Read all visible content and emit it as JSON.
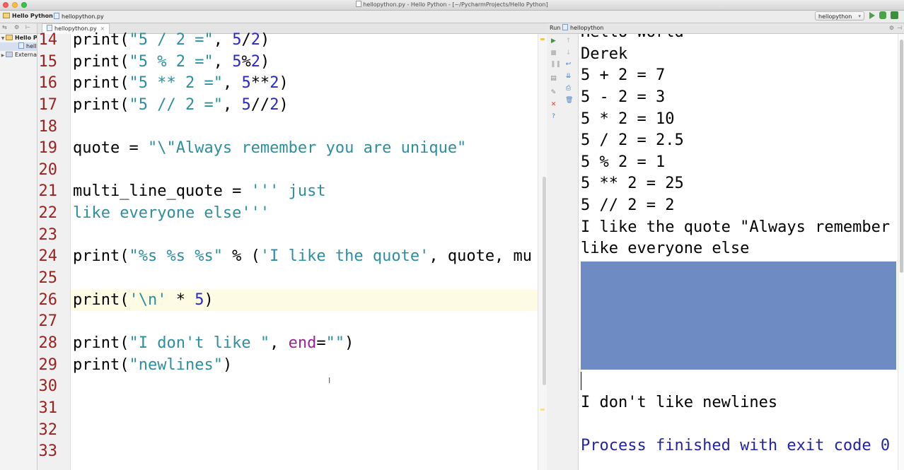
{
  "window": {
    "title": "hellopython.py - Hello Python - [~/PycharmProjects/Hello Python]"
  },
  "navbar": {
    "project": "Hello Python",
    "file": "hellopython.py",
    "run_config": "hellopython"
  },
  "project_panel": {
    "items": [
      "Hello P",
      "hell",
      "Externa"
    ]
  },
  "editor": {
    "tab_label": "hellopython.py",
    "highlighted_line": 26,
    "lines": [
      {
        "num": "14",
        "tokens": [
          [
            "p",
            "print("
          ],
          [
            "s",
            "\"5 / 2 =\""
          ],
          [
            "p",
            ", "
          ],
          [
            "n",
            "5"
          ],
          [
            "p",
            "/"
          ],
          [
            "n",
            "2"
          ],
          [
            "p",
            ")"
          ]
        ]
      },
      {
        "num": "15",
        "tokens": [
          [
            "p",
            "print("
          ],
          [
            "s",
            "\"5 % 2 =\""
          ],
          [
            "p",
            ", "
          ],
          [
            "n",
            "5"
          ],
          [
            "p",
            "%"
          ],
          [
            "n",
            "2"
          ],
          [
            "p",
            ")"
          ]
        ]
      },
      {
        "num": "16",
        "tokens": [
          [
            "p",
            "print("
          ],
          [
            "s",
            "\"5 ** 2 =\""
          ],
          [
            "p",
            ", "
          ],
          [
            "n",
            "5"
          ],
          [
            "p",
            "**"
          ],
          [
            "n",
            "2"
          ],
          [
            "p",
            ")"
          ]
        ]
      },
      {
        "num": "17",
        "tokens": [
          [
            "p",
            "print("
          ],
          [
            "s",
            "\"5 // 2 =\""
          ],
          [
            "p",
            ", "
          ],
          [
            "n",
            "5"
          ],
          [
            "p",
            "//"
          ],
          [
            "n",
            "2"
          ],
          [
            "p",
            ")"
          ]
        ]
      },
      {
        "num": "18",
        "tokens": []
      },
      {
        "num": "19",
        "tokens": [
          [
            "p",
            "quote = "
          ],
          [
            "s",
            "\"\\\"Always remember you are unique\""
          ]
        ]
      },
      {
        "num": "20",
        "tokens": []
      },
      {
        "num": "21",
        "tokens": [
          [
            "p",
            "multi_line_quote = "
          ],
          [
            "s",
            "''' just"
          ]
        ]
      },
      {
        "num": "22",
        "tokens": [
          [
            "s",
            "like everyone else'''"
          ]
        ]
      },
      {
        "num": "23",
        "tokens": []
      },
      {
        "num": "24",
        "tokens": [
          [
            "p",
            "print("
          ],
          [
            "s",
            "\"%s %s %s\""
          ],
          [
            "p",
            " % ("
          ],
          [
            "s",
            "'I like the quote'"
          ],
          [
            "p",
            ", quote, mu"
          ]
        ]
      },
      {
        "num": "25",
        "tokens": []
      },
      {
        "num": "26",
        "tokens": [
          [
            "p",
            "print("
          ],
          [
            "s",
            "'\\n'"
          ],
          [
            "p",
            " * "
          ],
          [
            "n",
            "5"
          ],
          [
            "p",
            ")"
          ]
        ]
      },
      {
        "num": "27",
        "tokens": []
      },
      {
        "num": "28",
        "tokens": [
          [
            "p",
            "print("
          ],
          [
            "s",
            "\"I don't like \""
          ],
          [
            "p",
            ", "
          ],
          [
            "k",
            "end"
          ],
          [
            "p",
            "="
          ],
          [
            "s",
            "\"\""
          ],
          [
            "p",
            ")"
          ]
        ]
      },
      {
        "num": "29",
        "tokens": [
          [
            "p",
            "print("
          ],
          [
            "s",
            "\"newlines\""
          ],
          [
            "p",
            ")"
          ]
        ]
      },
      {
        "num": "30",
        "tokens": []
      },
      {
        "num": "31",
        "tokens": []
      },
      {
        "num": "32",
        "tokens": []
      },
      {
        "num": "33",
        "tokens": []
      }
    ]
  },
  "run_panel": {
    "tab_label": "Run",
    "config": "hellopython",
    "output": [
      "Hello World",
      "Derek",
      "5 + 2 = 7",
      "5 - 2 = 3",
      "5 * 2 = 10",
      "5 / 2 = 2.5",
      "5 % 2 = 1",
      "5 ** 2 = 25",
      "5 // 2 = 2",
      "I like the quote \"Always remember",
      "like everyone else"
    ],
    "output_after_blank": "I don't like newlines",
    "exit_message": "Process finished with exit code 0"
  },
  "colors": {
    "selection": "#6e8cc3",
    "string": "#2c8fa0",
    "number": "#2828c8",
    "line_number": "#9c2121"
  }
}
